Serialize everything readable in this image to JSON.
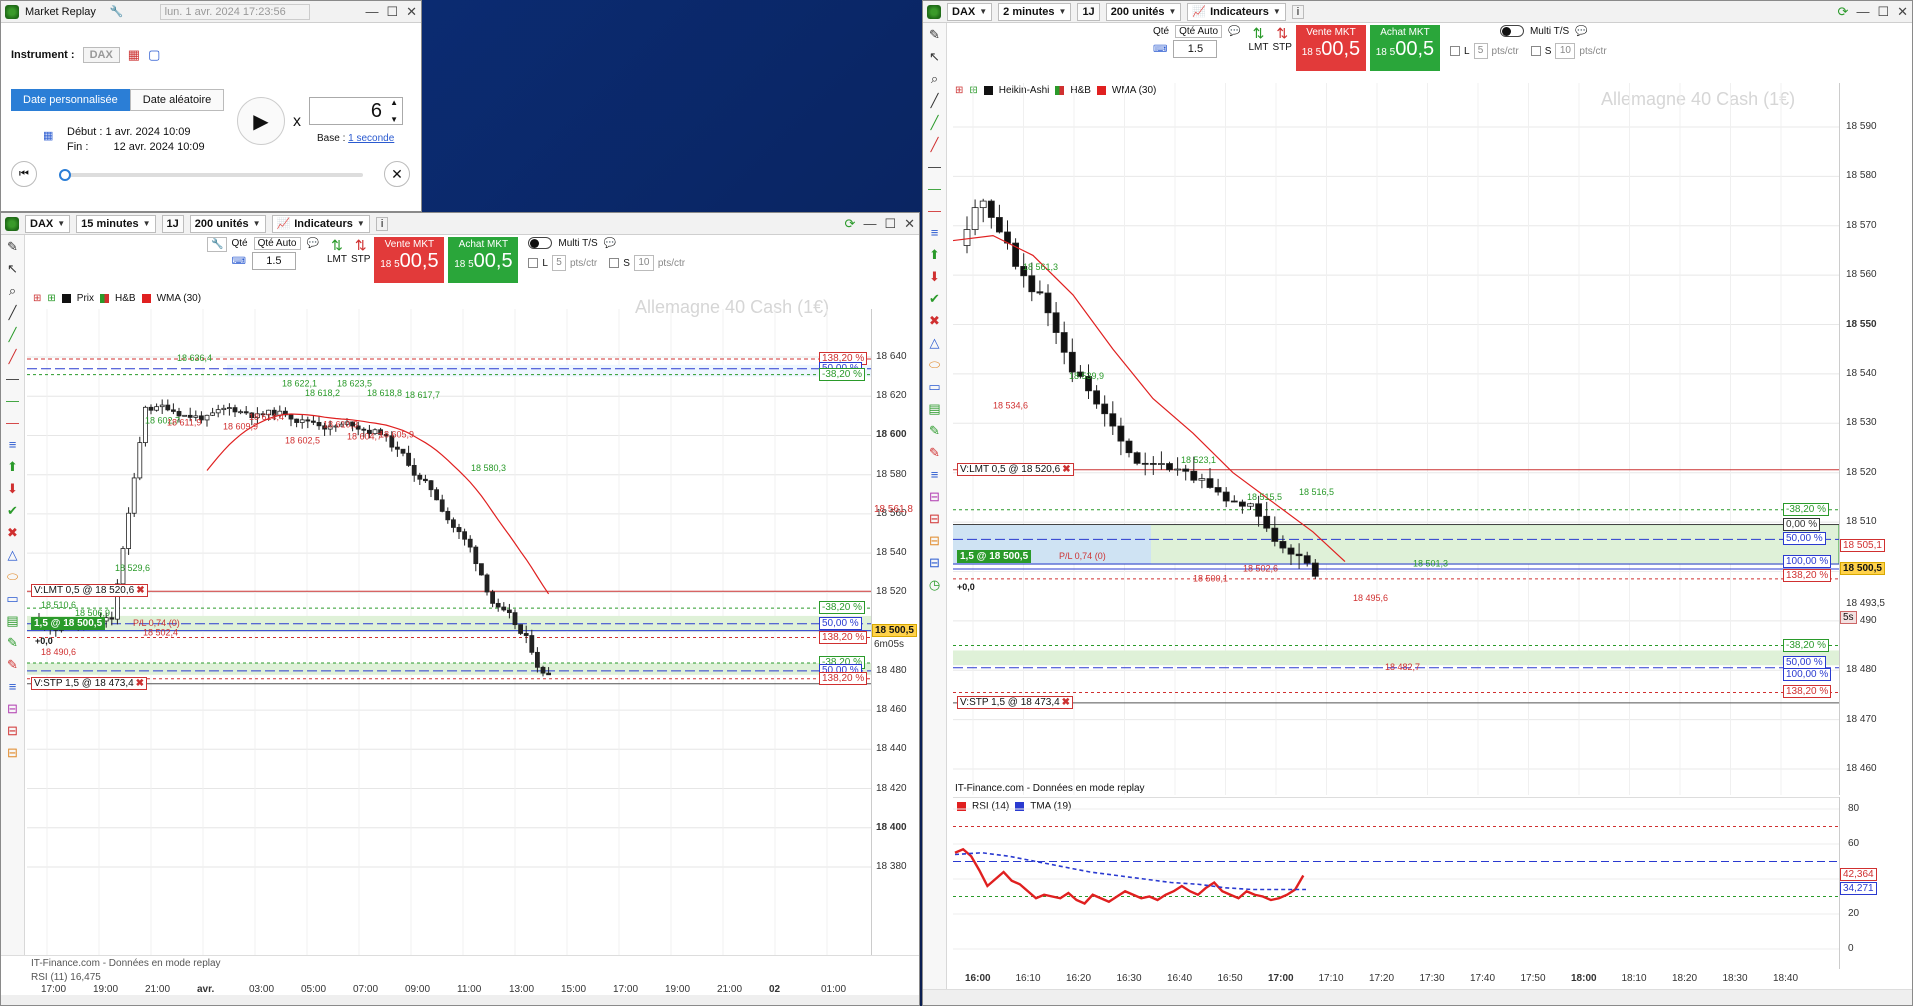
{
  "replay": {
    "title": "Market Replay",
    "date_input": "lun. 1 avr. 2024 17:23:56",
    "instrument_label": "Instrument :",
    "instrument_value": "DAX",
    "tab_custom": "Date personnalisée",
    "tab_random": "Date aléatoire",
    "start_label": "Début :",
    "start_value": "1 avr. 2024 10:09",
    "end_label": "Fin :",
    "end_value": "12 avr. 2024 10:09",
    "speed_prefix": "x",
    "speed_value": "6",
    "base_label": "Base :",
    "base_value": "1 seconde"
  },
  "left_chart": {
    "instrument": "DAX",
    "timeframe": "15 minutes",
    "period_btn": "1J",
    "units": "200 unités",
    "indicators_label": "Indicateurs",
    "qty_label": "Qté",
    "qty_auto": "Qté Auto",
    "qty_value": "1.5",
    "lmt_label": "LMT",
    "stp_label": "STP",
    "sell_title": "Vente MKT",
    "sell_small": "18 5",
    "sell_big": "00,5",
    "buy_title": "Achat MKT",
    "buy_small": "18 5",
    "buy_big": "00,5",
    "multi_ts": "Multi T/S",
    "l_label": "L",
    "l_val": "5",
    "s_label": "S",
    "s_val": "10",
    "pts_ctr": "pts/ctr",
    "legend_price": "Prix",
    "legend_hb": "H&B",
    "legend_wma": "WMA (30)",
    "watermark": "Allemagne 40 Cash (1€)",
    "price_ticks": [
      "18 640",
      "18 620",
      "18 600",
      "18 580",
      "18 560",
      "18 540",
      "18 520",
      "18 500",
      "18 480",
      "18 460",
      "18 440",
      "18 420",
      "18 400",
      "18 380"
    ],
    "bold_ticks": [
      "18 600",
      "18 400"
    ],
    "time_ticks": [
      "17:00",
      "19:00",
      "21:00",
      "avr.",
      "03:00",
      "05:00",
      "07:00",
      "09:00",
      "11:00",
      "13:00",
      "15:00",
      "17:00",
      "19:00",
      "21:00",
      "02",
      "01:00"
    ],
    "last_price": "18 500,5",
    "level_561": "18 561,8",
    "countdown": "6m05s",
    "pct_top": [
      "138,20 %",
      "50,00 %",
      "-38,20 %"
    ],
    "pct_mid": [
      "-38,20 %",
      "50,00 %",
      "138,20 %"
    ],
    "pct_bot": [
      "-38,20 %",
      "50,00 %",
      "138,20 %"
    ],
    "order_lmt": "V:LMT  0,5  @  18 520,6",
    "order_stp": "V:STP  1,5  @  18 473,4",
    "position": "1,5  @  18 500,5",
    "pl": "P/L  0,74 (0)",
    "zero": "+0,0",
    "annotations_green": [
      "18 636,4",
      "18 602,7",
      "18 622,1",
      "18 623,5",
      "18 618,2",
      "18 618,8",
      "18 617,7",
      "18 580,3",
      "18 529,6",
      "18 510,6",
      "18 506,9"
    ],
    "annotations_red": [
      "18 611,9",
      "18 609,9",
      "18 614,4",
      "18 602,5",
      "18 610,3",
      "18 604,7",
      "18 605,9",
      "18 502,4",
      "18 490,6"
    ],
    "footer_source": "IT-Finance.com - Données en mode replay",
    "rsi_label": "RSI (11)  16,475"
  },
  "right_chart": {
    "instrument": "DAX",
    "timeframe": "2 minutes",
    "period_btn": "1J",
    "units": "200 unités",
    "indicators_label": "Indicateurs",
    "qty_label": "Qté",
    "qty_auto": "Qté Auto",
    "qty_value": "1.5",
    "lmt_label": "LMT",
    "stp_label": "STP",
    "sell_title": "Vente MKT",
    "sell_small": "18 5",
    "sell_big": "00,5",
    "buy_title": "Achat MKT",
    "buy_small": "18 5",
    "buy_big": "00,5",
    "multi_ts": "Multi T/S",
    "l_label": "L",
    "l_val": "5",
    "s_label": "S",
    "s_val": "10",
    "pts_ctr": "pts/ctr",
    "legend_ha": "Heikin-Ashi",
    "legend_hb": "H&B",
    "legend_wma": "WMA (30)",
    "watermark": "Allemagne 40 Cash (1€)",
    "price_ticks": [
      "18 590",
      "18 580",
      "18 570",
      "18 560",
      "18 550",
      "18 540",
      "18 530",
      "18 520",
      "18 510",
      "18 500",
      "18 490",
      "18 480",
      "18 470",
      "18 460"
    ],
    "bold_ticks": [
      "18 550",
      "18 500"
    ],
    "time_ticks": [
      "16:00",
      "16:10",
      "16:20",
      "16:30",
      "16:40",
      "16:50",
      "17:00",
      "17:10",
      "17:20",
      "17:30",
      "17:40",
      "17:50",
      "18:00",
      "18:10",
      "18:20",
      "18:30",
      "18:40"
    ],
    "bold_time": [
      "16:00",
      "17:00",
      "18:00"
    ],
    "last_price": "18 500,5",
    "level_505": "18 505,1",
    "level_493": "18 493,5",
    "countdown": "5s",
    "pct_top": [
      "-38,20 %",
      "0,00 %",
      "50,00 %",
      "100,00 %",
      "138,20 %"
    ],
    "pct_bot": [
      "-38,20 %",
      "50,00 %",
      "100,00 %",
      "138,20 %"
    ],
    "order_lmt": "V:LMT  0,5  @  18 520,6",
    "order_stp": "V:STP  1,5  @  18 473,4",
    "position": "1,5  @  18 500,5",
    "pl": "P/L  0,74 (0)",
    "zero": "+0,0",
    "annotations_green": [
      "18 561,3",
      "18 539,9",
      "18 523,1",
      "18 515,5",
      "18 516,5",
      "18 501,3"
    ],
    "annotations_red": [
      "18 534,6",
      "18 502,6",
      "18 500,1",
      "18 495,6",
      "18 482,7"
    ],
    "footer_source": "IT-Finance.com - Données en mode replay",
    "rsi_label": "RSI (14)",
    "tma_label": "TMA (19)",
    "rsi_ticks": [
      "80",
      "60",
      "40",
      "20",
      "0"
    ],
    "rsi_value": "42,364",
    "tma_value": "34,271"
  }
}
